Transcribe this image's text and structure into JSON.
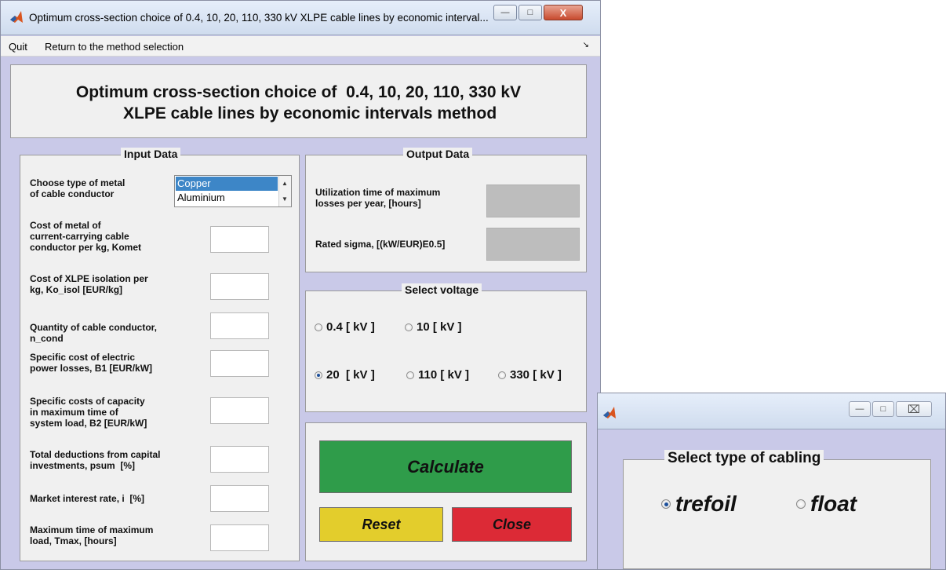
{
  "main_window": {
    "title": "Optimum cross-section choice of 0.4, 10, 20, 110, 330 kV XLPE cable lines by economic interval...",
    "controls": {
      "minimize": "—",
      "maximize": "□",
      "close": "X"
    }
  },
  "menu": {
    "quit": "Quit",
    "return": "Return to the method selection",
    "arrow": "↘"
  },
  "header": {
    "title": "Optimum cross-section choice of  0.4, 10, 20, 110, 330 kV\n     XLPE cable lines by economic intervals method"
  },
  "input_data": {
    "title": "Input Data",
    "metal_label": "Choose type of metal\nof cable conductor",
    "metal_options": [
      "Copper",
      "Aluminium"
    ],
    "metal_selected": "Copper",
    "fields": [
      {
        "label": "Cost of metal of\ncurrent-carrying cable\nconductor per kg, Komet",
        "value": ""
      },
      {
        "label": "Cost of XLPE isolation per\nkg, Ko_isol [EUR/kg]",
        "value": ""
      },
      {
        "label": "Quantity of cable conductor,\nn_cond",
        "value": ""
      },
      {
        "label": "Specific cost of electric\npower losses, B1 [EUR/kW]",
        "value": ""
      },
      {
        "label": "Specific costs of capacity\nin maximum time of\nsystem load, B2 [EUR/kW]",
        "value": ""
      },
      {
        "label": "Total deductions from capital\ninvestments, psum  [%]",
        "value": ""
      },
      {
        "label": "Market interest rate, i  [%]",
        "value": ""
      },
      {
        "label": "Maximum time of maximum\nload, Tmax, [hours]",
        "value": ""
      }
    ]
  },
  "output_data": {
    "title": "Output Data",
    "utilization_label": "Utilization time of maximum\nlosses per year, [hours]",
    "utilization_value": "",
    "sigma_label": "Rated sigma, [(kW/EUR)E0.5]",
    "sigma_value": ""
  },
  "voltage": {
    "title": "Select voltage",
    "options": [
      "0.4 [ kV ]",
      "10 [ kV ]",
      "20  [ kV ]",
      "110 [ kV ]",
      "330 [ kV ]"
    ],
    "selected": "20  [ kV ]"
  },
  "buttons": {
    "calculate": "Calculate",
    "reset": "Reset",
    "close": "Close"
  },
  "colors": {
    "calculate": "#2f9c4a",
    "reset": "#e3cd2c",
    "close": "#dc2a36",
    "panel_bg": "#c9c9e8"
  },
  "cabling_window": {
    "controls": {
      "minimize": "—",
      "maximize": "□",
      "close": "⌧"
    },
    "title": "Select type of cabling",
    "options": [
      "trefoil",
      "float"
    ],
    "selected": "trefoil"
  }
}
